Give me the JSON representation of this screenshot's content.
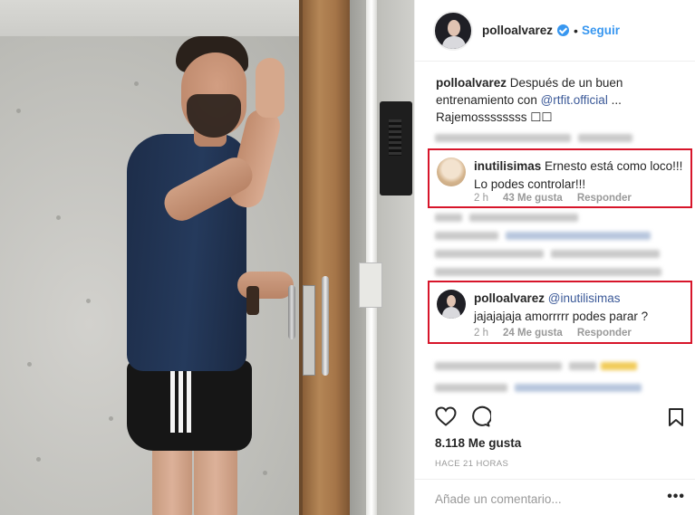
{
  "post": {
    "username": "polloalvarez",
    "follow_label": "Seguir",
    "dot": "•",
    "caption_text": "Después de un buen entrenamiento con",
    "caption_mention": "@rtfit.official",
    "caption_ellipsis": "...",
    "caption_line2": "Rajemossssssss ☐☐",
    "likes": "8.118 Me gusta",
    "time_ago": "HACE 21 HORAS",
    "add_comment_placeholder": "Añade un comentario...",
    "more": "•••"
  },
  "comments": [
    {
      "username": "inutilisimas",
      "text": "Ernesto está como loco!!! Lo podes controlar!!!",
      "age": "2 h",
      "likes": "43 Me gusta",
      "reply": "Responder"
    },
    {
      "username": "polloalvarez",
      "mention": "@inutilisimas",
      "text": "jajajajaja amorrrrr podes parar ?",
      "age": "2 h",
      "likes": "24 Me gusta",
      "reply": "Responder"
    }
  ],
  "icons": {
    "verified": "verified-badge-icon",
    "heart": "heart-icon",
    "comment": "comment-bubble-icon",
    "bookmark": "bookmark-icon"
  },
  "colors": {
    "link_blue": "#3897f0",
    "highlight_red": "#d7152a",
    "mention": "#3b5998"
  }
}
